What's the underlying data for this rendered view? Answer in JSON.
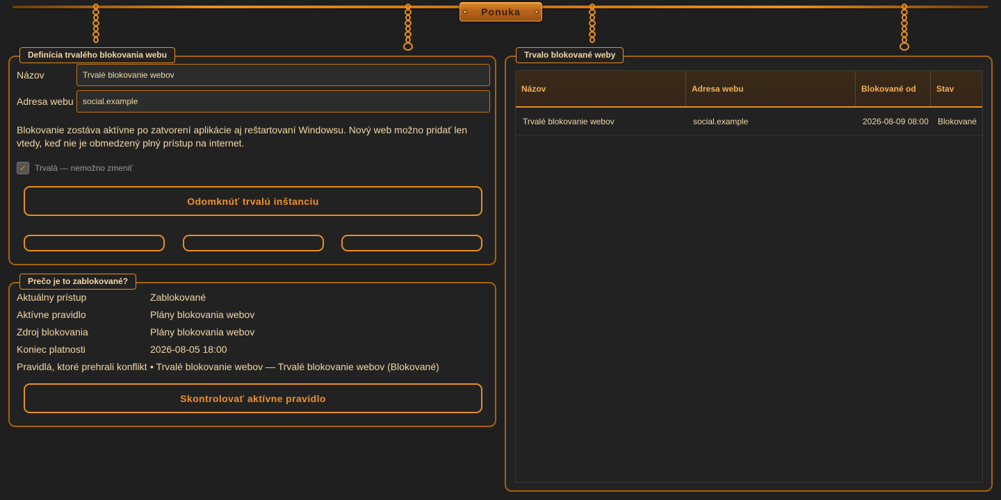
{
  "menu": {
    "label": "Ponuka"
  },
  "definition": {
    "title": "Definícia trvalého blokovania webu",
    "name_label": "Názov",
    "name_value": "Trvalé blokovanie webov",
    "address_label": "Adresa webu",
    "address_value": "social.example",
    "info": "Blokovanie zostáva aktívne po zatvorení aplikácie aj reštartovaní Windowsu. Nový web možno pridať len vtedy, keď nie je obmedzený plný prístup na internet.",
    "checkbox_label": "Trvalá — nemožno zmeniť",
    "checkbox_checked": true,
    "unlock_button": "Odomknúť trvalú inštanciu",
    "small_buttons": [
      "",
      "",
      ""
    ]
  },
  "why": {
    "title": "Prečo je to zablokované?",
    "rows": [
      {
        "key": "Aktuálny prístup",
        "value": "Zablokované"
      },
      {
        "key": "Aktívne pravidlo",
        "value": "Plány blokovania webov"
      },
      {
        "key": "Zdroj blokovania",
        "value": "Plány blokovania webov"
      },
      {
        "key": "Koniec platnosti",
        "value": "2026-08-05 18:00"
      },
      {
        "key": "Pravidlá, ktoré prehrali konflikt",
        "value": "• Trvalé blokovanie webov — Trvalé blokovanie webov (Blokované)"
      }
    ],
    "check_button": "Skontrolovať aktívne pravidlo"
  },
  "permanent": {
    "title": "Trvalo blokované weby",
    "columns": [
      "Názov",
      "Adresa webu",
      "Blokované od",
      "Stav"
    ],
    "rows": [
      [
        "Trvalé blokovanie webov",
        "social.example",
        "2026-08-09 08:00",
        "Blokované"
      ]
    ]
  },
  "colors": {
    "accent": "#e8901e",
    "background": "#1f1f1f",
    "text": "#f1d8a6"
  }
}
